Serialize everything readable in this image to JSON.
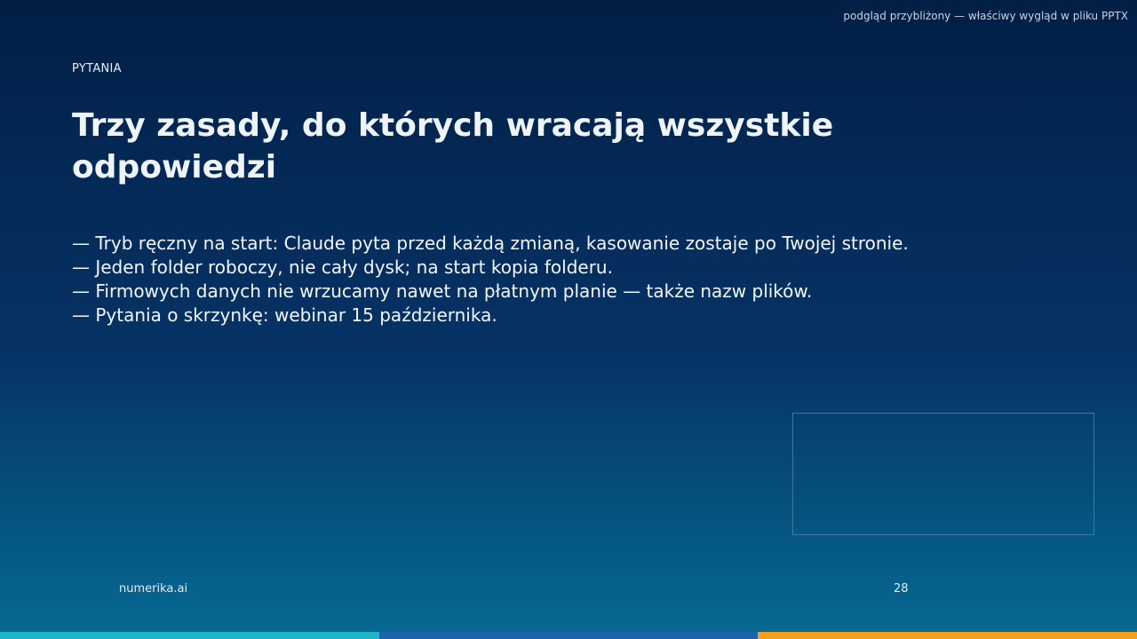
{
  "preview_note": "podgląd przybliżony — właściwy wygląd w pliku PPTX",
  "slide": {
    "eyebrow": "PYTANIA",
    "title": "Trzy zasady, do których wracają wszystkie odpowiedzi",
    "bullets": [
      "— Tryb ręczny na start: Claude pyta przed każdą zmianą, kasowanie zostaje po Twojej stronie.",
      "— Jeden folder roboczy, nie cały dysk; na start kopia folderu.",
      "— Firmowych danych nie wrzucamy nawet na płatnym planie — także nazw plików.",
      "— Pytania o skrzynkę: webinar 15 października."
    ],
    "footer_brand": "numerika.ai",
    "page_number": "28"
  },
  "colors": {
    "background_top": "#021f45",
    "background_bottom": "#066a93",
    "accent_bar": [
      "#1fb3c7",
      "#1a63ad",
      "#f59e1b"
    ],
    "placeholder_border": "#3f77a0"
  }
}
